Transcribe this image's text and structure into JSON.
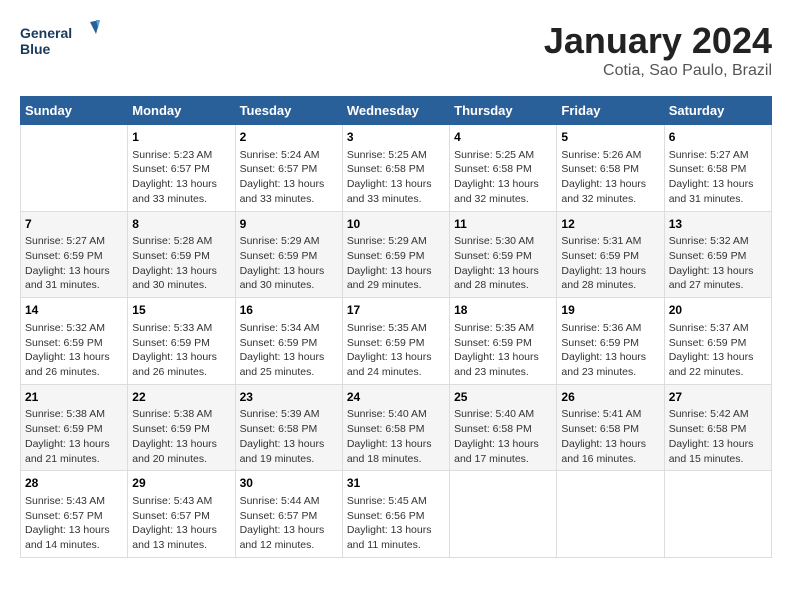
{
  "header": {
    "logo_line1": "General",
    "logo_line2": "Blue",
    "title": "January 2024",
    "subtitle": "Cotia, Sao Paulo, Brazil"
  },
  "columns": [
    "Sunday",
    "Monday",
    "Tuesday",
    "Wednesday",
    "Thursday",
    "Friday",
    "Saturday"
  ],
  "weeks": [
    [
      {
        "day": "",
        "info": ""
      },
      {
        "day": "1",
        "info": "Sunrise: 5:23 AM\nSunset: 6:57 PM\nDaylight: 13 hours\nand 33 minutes."
      },
      {
        "day": "2",
        "info": "Sunrise: 5:24 AM\nSunset: 6:57 PM\nDaylight: 13 hours\nand 33 minutes."
      },
      {
        "day": "3",
        "info": "Sunrise: 5:25 AM\nSunset: 6:58 PM\nDaylight: 13 hours\nand 33 minutes."
      },
      {
        "day": "4",
        "info": "Sunrise: 5:25 AM\nSunset: 6:58 PM\nDaylight: 13 hours\nand 32 minutes."
      },
      {
        "day": "5",
        "info": "Sunrise: 5:26 AM\nSunset: 6:58 PM\nDaylight: 13 hours\nand 32 minutes."
      },
      {
        "day": "6",
        "info": "Sunrise: 5:27 AM\nSunset: 6:58 PM\nDaylight: 13 hours\nand 31 minutes."
      }
    ],
    [
      {
        "day": "7",
        "info": "Sunrise: 5:27 AM\nSunset: 6:59 PM\nDaylight: 13 hours\nand 31 minutes."
      },
      {
        "day": "8",
        "info": "Sunrise: 5:28 AM\nSunset: 6:59 PM\nDaylight: 13 hours\nand 30 minutes."
      },
      {
        "day": "9",
        "info": "Sunrise: 5:29 AM\nSunset: 6:59 PM\nDaylight: 13 hours\nand 30 minutes."
      },
      {
        "day": "10",
        "info": "Sunrise: 5:29 AM\nSunset: 6:59 PM\nDaylight: 13 hours\nand 29 minutes."
      },
      {
        "day": "11",
        "info": "Sunrise: 5:30 AM\nSunset: 6:59 PM\nDaylight: 13 hours\nand 28 minutes."
      },
      {
        "day": "12",
        "info": "Sunrise: 5:31 AM\nSunset: 6:59 PM\nDaylight: 13 hours\nand 28 minutes."
      },
      {
        "day": "13",
        "info": "Sunrise: 5:32 AM\nSunset: 6:59 PM\nDaylight: 13 hours\nand 27 minutes."
      }
    ],
    [
      {
        "day": "14",
        "info": "Sunrise: 5:32 AM\nSunset: 6:59 PM\nDaylight: 13 hours\nand 26 minutes."
      },
      {
        "day": "15",
        "info": "Sunrise: 5:33 AM\nSunset: 6:59 PM\nDaylight: 13 hours\nand 26 minutes."
      },
      {
        "day": "16",
        "info": "Sunrise: 5:34 AM\nSunset: 6:59 PM\nDaylight: 13 hours\nand 25 minutes."
      },
      {
        "day": "17",
        "info": "Sunrise: 5:35 AM\nSunset: 6:59 PM\nDaylight: 13 hours\nand 24 minutes."
      },
      {
        "day": "18",
        "info": "Sunrise: 5:35 AM\nSunset: 6:59 PM\nDaylight: 13 hours\nand 23 minutes."
      },
      {
        "day": "19",
        "info": "Sunrise: 5:36 AM\nSunset: 6:59 PM\nDaylight: 13 hours\nand 23 minutes."
      },
      {
        "day": "20",
        "info": "Sunrise: 5:37 AM\nSunset: 6:59 PM\nDaylight: 13 hours\nand 22 minutes."
      }
    ],
    [
      {
        "day": "21",
        "info": "Sunrise: 5:38 AM\nSunset: 6:59 PM\nDaylight: 13 hours\nand 21 minutes."
      },
      {
        "day": "22",
        "info": "Sunrise: 5:38 AM\nSunset: 6:59 PM\nDaylight: 13 hours\nand 20 minutes."
      },
      {
        "day": "23",
        "info": "Sunrise: 5:39 AM\nSunset: 6:58 PM\nDaylight: 13 hours\nand 19 minutes."
      },
      {
        "day": "24",
        "info": "Sunrise: 5:40 AM\nSunset: 6:58 PM\nDaylight: 13 hours\nand 18 minutes."
      },
      {
        "day": "25",
        "info": "Sunrise: 5:40 AM\nSunset: 6:58 PM\nDaylight: 13 hours\nand 17 minutes."
      },
      {
        "day": "26",
        "info": "Sunrise: 5:41 AM\nSunset: 6:58 PM\nDaylight: 13 hours\nand 16 minutes."
      },
      {
        "day": "27",
        "info": "Sunrise: 5:42 AM\nSunset: 6:58 PM\nDaylight: 13 hours\nand 15 minutes."
      }
    ],
    [
      {
        "day": "28",
        "info": "Sunrise: 5:43 AM\nSunset: 6:57 PM\nDaylight: 13 hours\nand 14 minutes."
      },
      {
        "day": "29",
        "info": "Sunrise: 5:43 AM\nSunset: 6:57 PM\nDaylight: 13 hours\nand 13 minutes."
      },
      {
        "day": "30",
        "info": "Sunrise: 5:44 AM\nSunset: 6:57 PM\nDaylight: 13 hours\nand 12 minutes."
      },
      {
        "day": "31",
        "info": "Sunrise: 5:45 AM\nSunset: 6:56 PM\nDaylight: 13 hours\nand 11 minutes."
      },
      {
        "day": "",
        "info": ""
      },
      {
        "day": "",
        "info": ""
      },
      {
        "day": "",
        "info": ""
      }
    ]
  ]
}
